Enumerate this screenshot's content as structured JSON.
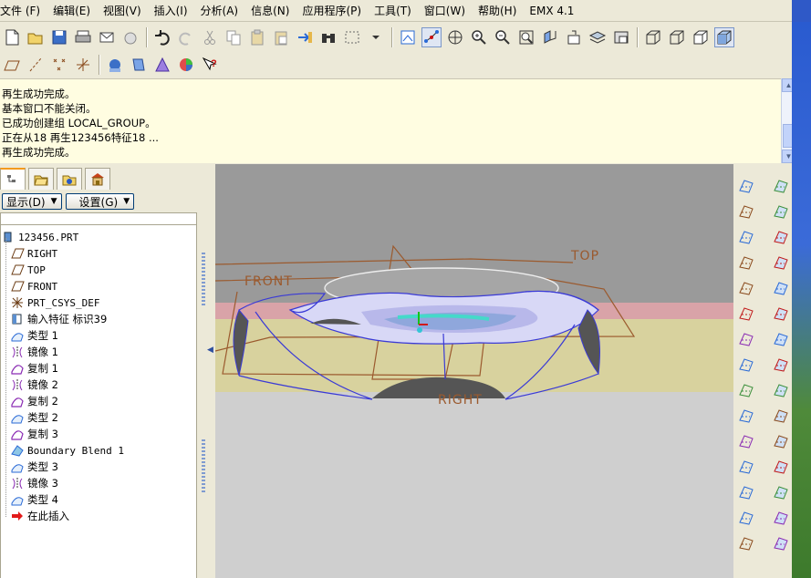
{
  "menu": [
    "文件 (F)",
    "编辑(E)",
    "视图(V)",
    "插入(I)",
    "分析(A)",
    "信息(N)",
    "应用程序(P)",
    "工具(T)",
    "窗口(W)",
    "帮助(H)",
    "EMX 4.1"
  ],
  "toolbar1_icons": [
    "new-file-icon",
    "open-folder-icon",
    "save-icon",
    "print-icon",
    "send-mail-icon",
    "cloud-icon",
    "undo-icon",
    "redo-icon",
    "cut-icon",
    "copy-icon",
    "paste-icon",
    "paste-special-icon",
    "regenerate-icon",
    "find-icon",
    "select-box-icon",
    "dropdown-icon",
    "repaint-icon",
    "spin-center-icon",
    "orient-icon",
    "zoom-in-icon",
    "zoom-out-icon",
    "refit-icon",
    "reorient-icon",
    "saved-views-icon",
    "layers-icon",
    "view-manager-icon",
    "wireframe-icon",
    "hidden-line-icon",
    "no-hidden-icon",
    "shading-icon"
  ],
  "toolbar2_icons": [
    "datum-planes-icon",
    "datum-axes-icon",
    "datum-points-icon",
    "csys-icon",
    "annotation-icon",
    "spool-icon",
    "appearance-icon",
    "color-wheel-icon",
    "context-help-icon"
  ],
  "messages": [
    "再生成功完成。",
    "基本窗口不能关闭。",
    "已成功创建组 LOCAL_GROUP。",
    "正在从18 再生123456特征18 ...",
    "再生成功完成。"
  ],
  "nav": {
    "display_label": "显示(D)",
    "settings_label": "设置(G)"
  },
  "tree": [
    {
      "label": "123456.PRT",
      "icon": "part-icon",
      "cjk": false
    },
    {
      "label": "RIGHT",
      "icon": "datum-plane-icon",
      "cjk": false
    },
    {
      "label": "TOP",
      "icon": "datum-plane-icon",
      "cjk": false
    },
    {
      "label": "FRONT",
      "icon": "datum-plane-icon",
      "cjk": false
    },
    {
      "label": "PRT_CSYS_DEF",
      "icon": "csys-icon",
      "cjk": false
    },
    {
      "label": "输入特征 标识39",
      "icon": "import-feature-icon",
      "cjk": true
    },
    {
      "label": "类型 1",
      "icon": "surface-icon",
      "cjk": true
    },
    {
      "label": "镜像 1",
      "icon": "mirror-icon",
      "cjk": true
    },
    {
      "label": "复制 1",
      "icon": "copy-feature-icon",
      "cjk": true
    },
    {
      "label": "镜像 2",
      "icon": "mirror-icon",
      "cjk": true
    },
    {
      "label": "复制 2",
      "icon": "copy-feature-icon",
      "cjk": true
    },
    {
      "label": "类型 2",
      "icon": "surface-icon",
      "cjk": true
    },
    {
      "label": "复制 3",
      "icon": "copy-feature-icon",
      "cjk": true
    },
    {
      "label": "Boundary Blend 1",
      "icon": "boundary-blend-icon",
      "cjk": false
    },
    {
      "label": "类型 3",
      "icon": "surface-icon",
      "cjk": true
    },
    {
      "label": "镜像 3",
      "icon": "mirror-icon",
      "cjk": true
    },
    {
      "label": "类型 4",
      "icon": "surface-icon",
      "cjk": true
    },
    {
      "label": "在此插入",
      "icon": "insert-here-arrow-icon",
      "cjk": true
    }
  ],
  "graphics": {
    "datum_labels": {
      "front": "FRONT",
      "top": "TOP",
      "right": "RIGHT"
    }
  },
  "right_tools_col1": [
    "sketched-datum-curve-icon",
    "datum-plane-tool-icon",
    "datum-axis-tool-icon",
    "datum-curve-tool-icon",
    "datum-point-tool-icon",
    "csys-tool-icon",
    "analysis-tool-icon",
    "round-tool-icon",
    "intent-datum-icon",
    "shell-tool-icon",
    "rib-tool-icon",
    "draft-tool-icon",
    "sweep-tool-icon",
    "blend-tool-icon",
    "extend-tool-icon"
  ],
  "right_tools_col2": [
    "extrude-tool-icon",
    "revolve-tool-icon",
    "variable-sweep-icon",
    "boundary-blend-tool-icon",
    "style-tool-icon",
    "fill-tool-icon",
    "merge-tool-icon",
    "trim-tool-icon",
    "pattern-tool-icon",
    "mirror-tool-icon",
    "offset-tool-icon",
    "warp-tool-icon",
    "thicken-tool-icon",
    "solidify-tool-icon",
    "sketch-region-icon"
  ],
  "colors": {
    "message_bg": "#fffde1",
    "viewport_top": "#9a9a9a",
    "viewport_pink": "#d9a3a8",
    "viewport_yellow": "#d8d29e",
    "viewport_bottom": "#cfcfcf",
    "datum_line": "#9b5a2e",
    "edge_blue": "#3a3ad6"
  }
}
